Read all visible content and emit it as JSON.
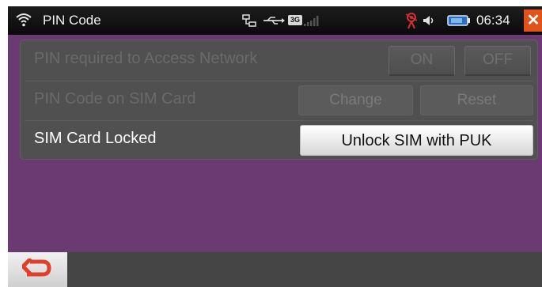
{
  "statusbar": {
    "title": "PIN Code",
    "network_badge": "3G",
    "time": "06:34",
    "icons": [
      "wifi-icon",
      "network-icon",
      "usb-icon",
      "signal-icon",
      "gps-icon",
      "speaker-icon",
      "battery-icon",
      "close-icon"
    ]
  },
  "settings": {
    "row1": {
      "label": "PIN required to Access Network",
      "on": "ON",
      "off": "OFF"
    },
    "row2": {
      "label": "PIN Code on SIM Card",
      "change": "Change",
      "reset": "Reset"
    },
    "row3": {
      "label": "SIM Card Locked",
      "unlock": "Unlock SIM with PUK"
    }
  },
  "bottombar": {
    "back_icon": "back-arrow-icon"
  },
  "colors": {
    "background": "#6b3a73",
    "panel": "#505050",
    "close": "#e2531b",
    "back_arrow": "#e0402a"
  }
}
